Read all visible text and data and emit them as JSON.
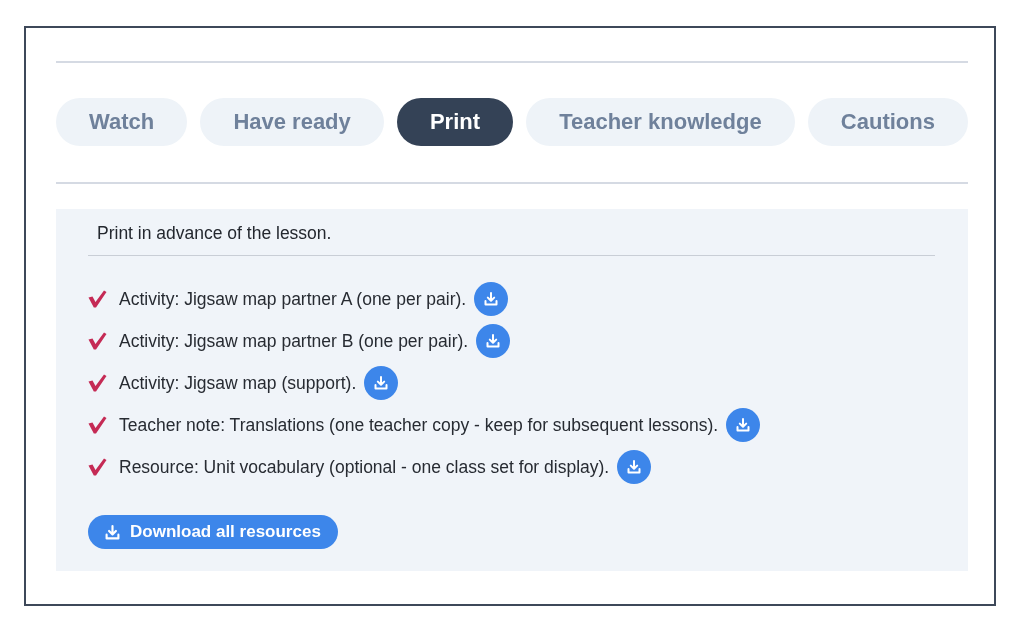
{
  "tabs": [
    {
      "label": "Watch",
      "selected": false
    },
    {
      "label": "Have ready",
      "selected": false
    },
    {
      "label": "Print",
      "selected": true
    },
    {
      "label": "Teacher knowledge",
      "selected": false
    },
    {
      "label": "Cautions",
      "selected": false
    }
  ],
  "panel": {
    "heading": "Print in advance of the lesson.",
    "items": [
      {
        "text": "Activity: Jigsaw map partner A (one per pair)."
      },
      {
        "text": "Activity: Jigsaw map partner B (one per pair)."
      },
      {
        "text": "Activity: Jigsaw map (support)."
      },
      {
        "text": "Teacher note: Translations (one teacher copy - keep for subsequent lessons)."
      },
      {
        "text": "Resource: Unit vocabulary (optional - one class set for display)."
      }
    ],
    "download_all": {
      "label": "Download all resources"
    }
  }
}
